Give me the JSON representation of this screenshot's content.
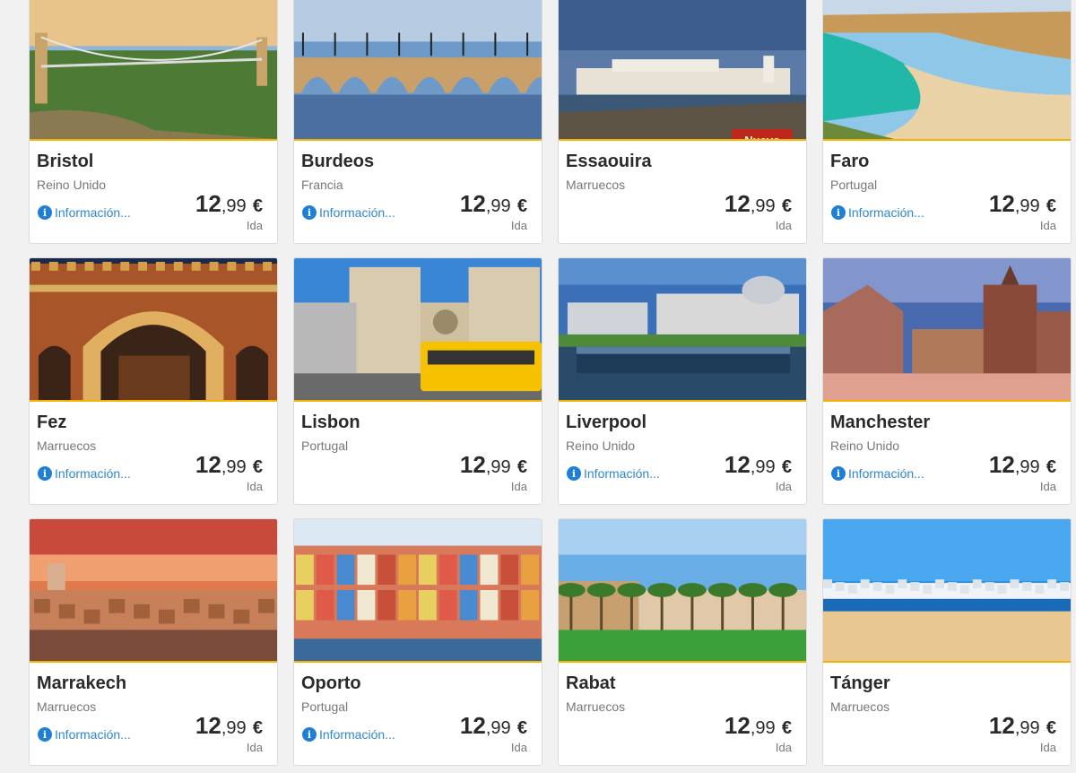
{
  "destinations": [
    {
      "city": "Bristol",
      "country": "Reino Unido",
      "info": "Información...",
      "price_int": "12",
      "price_dec": ",99",
      "currency": "€",
      "trip": "Ida",
      "badge": "",
      "scene": "bridge"
    },
    {
      "city": "Burdeos",
      "country": "Francia",
      "info": "Información...",
      "price_int": "12",
      "price_dec": ",99",
      "currency": "€",
      "trip": "Ida",
      "badge": "",
      "scene": "arch-bridge"
    },
    {
      "city": "Essaouira",
      "country": "Marruecos",
      "info": "",
      "price_int": "12",
      "price_dec": ",99",
      "currency": "€",
      "trip": "Ida",
      "badge": "Nuevo",
      "scene": "coast-fort"
    },
    {
      "city": "Faro",
      "country": "Portugal",
      "info": "Información...",
      "price_int": "12",
      "price_dec": ",99",
      "currency": "€",
      "trip": "Ida",
      "badge": "",
      "scene": "beach-cliff"
    },
    {
      "city": "Fez",
      "country": "Marruecos",
      "info": "Información...",
      "price_int": "12",
      "price_dec": ",99",
      "currency": "€",
      "trip": "Ida",
      "badge": "",
      "scene": "gate"
    },
    {
      "city": "Lisbon",
      "country": "Portugal",
      "info": "",
      "price_int": "12",
      "price_dec": ",99",
      "currency": "€",
      "trip": "Ida",
      "badge": "",
      "scene": "cathedral-tram"
    },
    {
      "city": "Liverpool",
      "country": "Reino Unido",
      "info": "Información...",
      "price_int": "12",
      "price_dec": ",99",
      "currency": "€",
      "trip": "Ida",
      "badge": "",
      "scene": "dock"
    },
    {
      "city": "Manchester",
      "country": "Reino Unido",
      "info": "Información...",
      "price_int": "12",
      "price_dec": ",99",
      "currency": "€",
      "trip": "Ida",
      "badge": "",
      "scene": "townhall"
    },
    {
      "city": "Marrakech",
      "country": "Marruecos",
      "info": "Información...",
      "price_int": "12",
      "price_dec": ",99",
      "currency": "€",
      "trip": "Ida",
      "badge": "",
      "scene": "sunset-city"
    },
    {
      "city": "Oporto",
      "country": "Portugal",
      "info": "Información...",
      "price_int": "12",
      "price_dec": ",99",
      "currency": "€",
      "trip": "Ida",
      "badge": "",
      "scene": "riverside"
    },
    {
      "city": "Rabat",
      "country": "Marruecos",
      "info": "",
      "price_int": "12",
      "price_dec": ",99",
      "currency": "€",
      "trip": "Ida",
      "badge": "",
      "scene": "palms"
    },
    {
      "city": "Tánger",
      "country": "Marruecos",
      "info": "",
      "price_int": "12",
      "price_dec": ",99",
      "currency": "€",
      "trip": "Ida",
      "badge": "",
      "scene": "sea-town"
    }
  ],
  "colors": {
    "accent_line": "#f3b300",
    "badge_bg": "#c0271c",
    "info_link": "#2f87d2"
  }
}
